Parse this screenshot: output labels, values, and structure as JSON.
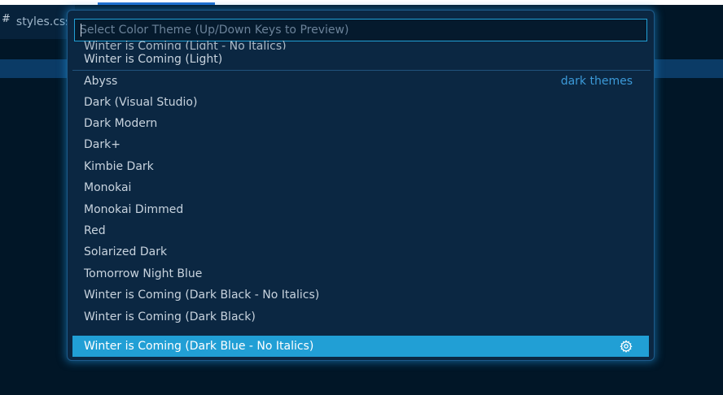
{
  "editor": {
    "tab_icon": "#",
    "tab_name": "styles.css"
  },
  "quickpick": {
    "placeholder": "Select Color Theme (Up/Down Keys to Preview)",
    "partial_item": "Winter is Coming (Light - No Italics)",
    "light_last": "Winter is Coming (Light)",
    "group_label": "dark themes",
    "items": [
      "Abyss",
      "Dark (Visual Studio)",
      "Dark Modern",
      "Dark+",
      "Kimbie Dark",
      "Monokai",
      "Monokai Dimmed",
      "Red",
      "Solarized Dark",
      "Tomorrow Night Blue",
      "Winter is Coming (Dark Black - No Italics)",
      "Winter is Coming (Dark Black)",
      "Winter is Coming (Dark Blue - No Italics)"
    ],
    "selected_index": 12,
    "icons": {
      "selected_action": "gear-icon"
    }
  },
  "colors": {
    "background": "#011627",
    "panel": "#0b2742",
    "accent": "#219fd5",
    "group_label": "#3c9ad8",
    "text": "#c8d3de"
  }
}
